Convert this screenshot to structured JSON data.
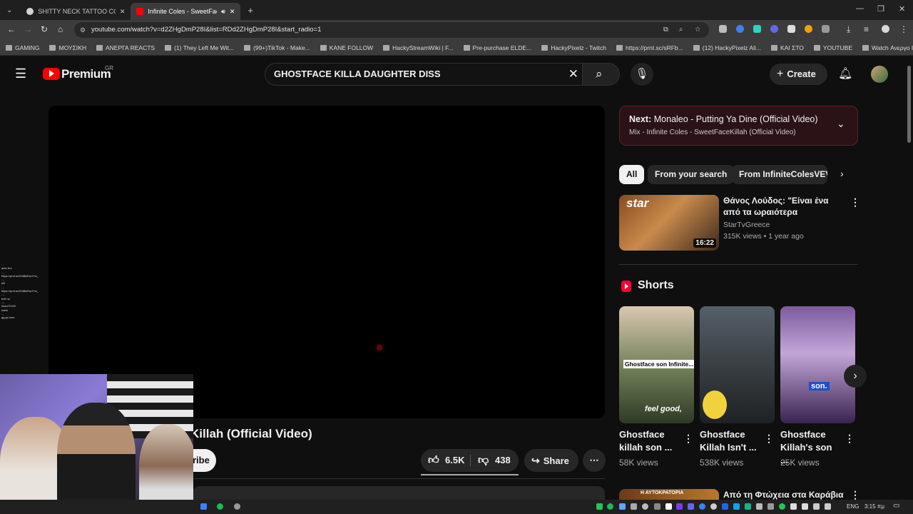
{
  "browser": {
    "tabs": [
      {
        "title": "SHITTY NECK TATTOO COMPIL",
        "active": false
      },
      {
        "title": "Infinite Coles - SweetFaceK",
        "active": true
      }
    ],
    "url": "youtube.com/watch?v=d2ZHgDmP28I&list=RDd2ZHgDmP28I&start_radio=1",
    "bookmarks": [
      "GAMING",
      "ΜΟΥΣΙΚΗ",
      "ΑΝΕΡΓΑ REACTS",
      "(1) They Left Me Wit...",
      "(99+)TikTok - Make...",
      "KANE FOLLOW",
      "HackyStreamWiki | F...",
      "Pre-purchase ELDE...",
      "HackyPixelz - Twitch",
      "https://prnt.sc/sRFb...",
      "(12) HackyPixelz Ali...",
      "ΚΑΙ ΣΤΟ",
      "YOUTUBE",
      "Watch Ανεργο Intro..."
    ]
  },
  "yt": {
    "logo": "Premium",
    "region": "GR",
    "search_value": "GHOSTFACE KILLA DAUGHTER DISS",
    "create": "Create",
    "video_title_visible": "Killah (Official Video)",
    "subscribe_partial": "ribe",
    "likes": "6.5K",
    "dislikes": "438",
    "share": "Share",
    "next_label": "Next:",
    "next_title": "Monaleo - Putting Ya Dine (Official Video)",
    "next_sub": "Mix - Infinite Coles - SweetFaceKillah (Official Video)",
    "chips": [
      "All",
      "From your search",
      "From InfiniteColesVEVO"
    ],
    "rec": {
      "title": "Θάνος Λούδος: \"Είναι ένα από τα ωραιότερα αντικείμενα πο...",
      "channel": "StarTvGreece",
      "meta": "315K views • 1 year ago",
      "duration": "16:22",
      "thumb_text": "star"
    },
    "shorts_label": "Shorts",
    "shorts": [
      {
        "title": "Ghostface killah son ...",
        "views": "58K views",
        "overlay": "Ghostface son Infinite...",
        "caption": "feel good,"
      },
      {
        "title": "Ghostface Killah Isn't ...",
        "views": "538K views",
        "overlay": "",
        "caption": ""
      },
      {
        "title": "Ghostface Killah's son ...",
        "views": "25K views",
        "overlay": "son.",
        "caption": ""
      }
    ],
    "bottom_rec_title": "Από τη Φτώχεια στα Καράβια",
    "bottom_thumb_text": "Η ΑΥΤΟΚΡΑΤΟΡΙΑ"
  },
  "chat": [
    "auto bro",
    "https://prnt.sc/2088zDuUYw_",
    "elll",
    "https://prnt.sc/2088zDuUYw_",
    "hell no",
    "lmao72100",
    "nahh",
    "gg go won"
  ],
  "taskbar": {
    "lang": "ENG",
    "time": "3:15 πμ"
  }
}
